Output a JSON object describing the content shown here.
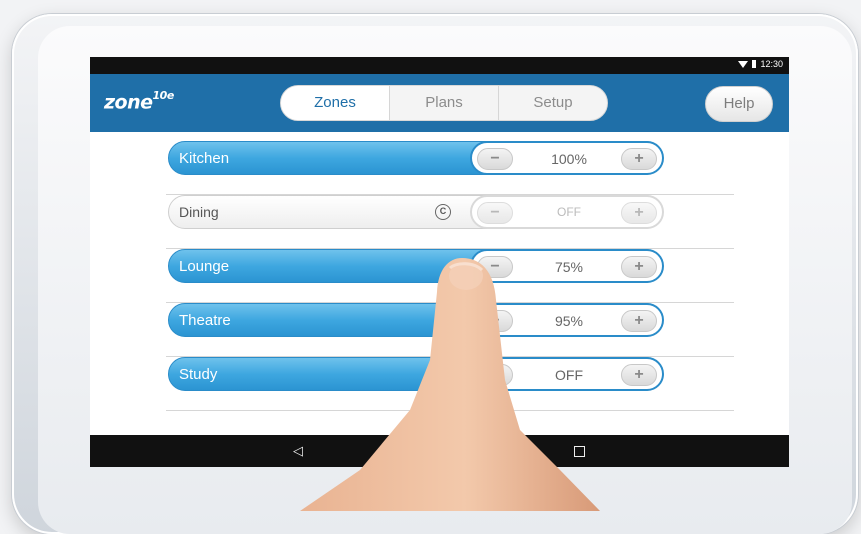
{
  "status": {
    "time": "12:30"
  },
  "app": {
    "logo_main": "zone",
    "logo_sup": "10e"
  },
  "tabs": [
    {
      "label": "Zones",
      "active": true
    },
    {
      "label": "Plans",
      "active": false
    },
    {
      "label": "Setup",
      "active": false
    }
  ],
  "help_label": "Help",
  "zones": [
    {
      "name": "Kitchen",
      "level": "100%",
      "on": true
    },
    {
      "name": "Dining",
      "level": "OFF",
      "on": false,
      "climate_icon": "C"
    },
    {
      "name": "Lounge",
      "level": "75%",
      "on": true
    },
    {
      "name": "Theatre",
      "level": "95%",
      "on": true
    },
    {
      "name": "Study",
      "level": "OFF",
      "on": true
    }
  ],
  "controls": {
    "minus": "−",
    "plus": "+"
  },
  "nav": {
    "back": "◁"
  },
  "colors": {
    "accent": "#1f6fa8",
    "zone_on": "#3ea7e0",
    "status_bar": "#111111"
  }
}
